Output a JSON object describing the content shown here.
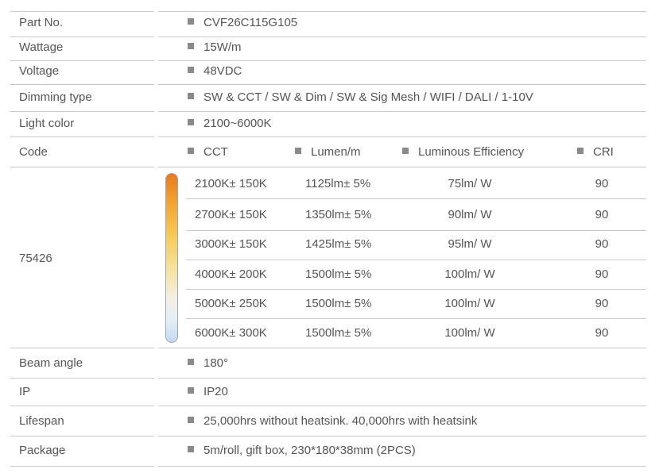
{
  "rows_top": [
    {
      "label": "Part  No.",
      "value": "CVF26C115G105"
    },
    {
      "label": "Wattage",
      "value": "15W/m"
    },
    {
      "label": "Voltage",
      "value": "48VDC"
    },
    {
      "label": "Dimming type",
      "value": "SW & CCT /  SW & Dim / SW & Sig Mesh / WIFI / DALI / 1-10V"
    },
    {
      "label": "Light color",
      "value": "2100~6000K"
    }
  ],
  "code": {
    "label": "Code",
    "columns": [
      "CCT",
      "Lumen/m",
      "Luminous Efficiency",
      "CRI"
    ],
    "code_value": "75426",
    "rows": [
      {
        "cct": "2100K± 150K",
        "lumen": "1125lm± 5%",
        "efficiency": "75lm/ W",
        "cri": "90"
      },
      {
        "cct": "2700K± 150K",
        "lumen": "1350lm± 5%",
        "efficiency": "90lm/ W",
        "cri": "90"
      },
      {
        "cct": "3000K± 150K",
        "lumen": "1425lm± 5%",
        "efficiency": "95lm/ W",
        "cri": "90"
      },
      {
        "cct": "4000K± 200K",
        "lumen": "1500lm± 5%",
        "efficiency": "100lm/ W",
        "cri": "90"
      },
      {
        "cct": "5000K± 250K",
        "lumen": "1500lm± 5%",
        "efficiency": "100lm/ W",
        "cri": "90"
      },
      {
        "cct": "6000K± 300K",
        "lumen": "1500lm± 5%",
        "efficiency": "100lm/ W",
        "cri": "90"
      }
    ]
  },
  "rows_bottom": [
    {
      "label": "Beam angle",
      "value": "180°"
    },
    {
      "label": "IP",
      "value": "IP20"
    },
    {
      "label": "Lifespan",
      "value": "25,000hrs without heatsink. 40,000hrs with heatsink"
    },
    {
      "label": "Package",
      "value": "5m/roll, gift box, 230*180*38mm (2PCS)"
    }
  ],
  "colors": {
    "text": "#555555",
    "rule": "#c9c9c9",
    "bullet": "#8a8a8a",
    "gradient_warm": "#e67a20",
    "gradient_cool": "#c3d9f1"
  }
}
